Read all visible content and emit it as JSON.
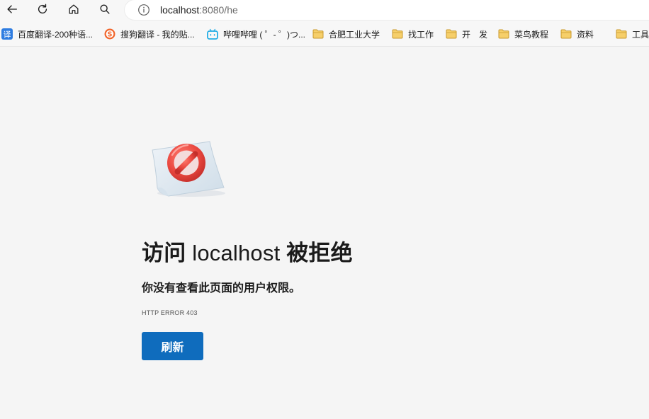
{
  "toolbar": {
    "back_icon": "back-arrow-icon",
    "refresh_icon": "refresh-icon",
    "home_icon": "home-icon",
    "search_icon": "search-icon"
  },
  "address_bar": {
    "info_icon": "info-icon",
    "url_host": "localhost",
    "url_rest": ":8080/he"
  },
  "favorites": [
    {
      "label": "百度翻译-200种语...",
      "icon": "baidu-translate-icon"
    },
    {
      "label": "搜狗翻译 - 我的贴...",
      "icon": "sogou-icon"
    },
    {
      "label": "哔哩哔哩 ( ゜- ゜)つ...",
      "icon": "bilibili-icon"
    },
    {
      "label": "合肥工业大学",
      "icon": "folder-icon"
    },
    {
      "label": "找工作",
      "icon": "folder-icon"
    },
    {
      "label": "开　发",
      "icon": "folder-icon"
    },
    {
      "label": "菜鸟教程",
      "icon": "folder-icon"
    },
    {
      "label": "资料",
      "icon": "folder-icon"
    },
    {
      "label": "工具",
      "icon": "folder-icon"
    }
  ],
  "error_page": {
    "title_prefix": "访问",
    "title_host": "localhost",
    "title_suffix": "被拒绝",
    "description": "你没有查看此页面的用户权限。",
    "error_code": "HTTP ERROR 403",
    "refresh_label": "刷新",
    "illustration": "prohibited-sign-icon"
  },
  "colors": {
    "accent": "#0f6cbd",
    "background": "#f5f5f5",
    "folder": "#f2c35a",
    "prohibited_red": "#e8433f"
  }
}
